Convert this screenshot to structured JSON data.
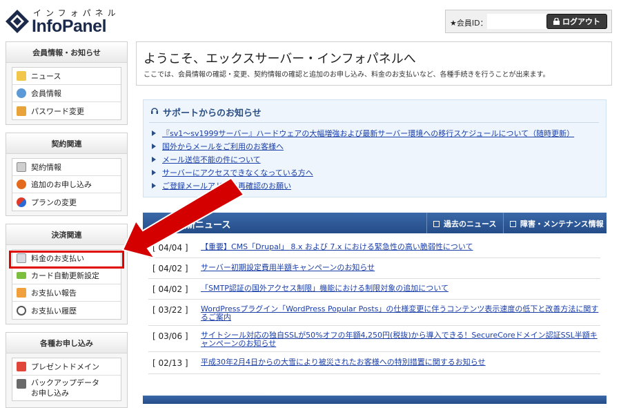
{
  "header": {
    "logo_kana": "インフォパネル",
    "logo_text": "InfoPanel",
    "member_label": "★会員ID：",
    "logout_label": "ログアウト"
  },
  "sidebar": {
    "sections": [
      {
        "title": "会員情報・お知らせ",
        "items": [
          "ニュース",
          "会員情報",
          "パスワード変更"
        ]
      },
      {
        "title": "契約関連",
        "items": [
          "契約情報",
          "追加のお申し込み",
          "プランの変更"
        ]
      },
      {
        "title": "決済関連",
        "items": [
          "料金のお支払い",
          "カード自動更新設定",
          "お支払い報告",
          "お支払い履歴"
        ]
      },
      {
        "title": "各種お申し込み",
        "items": [
          "プレゼントドメイン",
          "バックアップデータ",
          "お申し込み"
        ]
      }
    ]
  },
  "welcome": {
    "title": "ようこそ、エックスサーバー・インフォパネルへ",
    "subtitle": "ここでは、会員情報の確認・変更、契約情報の確認と追加のお申し込み、料金のお支払いなど、各種手続きを行うことが出来ます。"
  },
  "support": {
    "title": "サポートからのお知らせ",
    "items": [
      "『sv1〜sv1999サーバー』ハードウェアの大幅増強および最新サーバー環境への移行スケジュールについて（随時更新）",
      "国外からメールをご利用のお客様へ",
      "メール送信不能の件について",
      "サーバーにアクセスできなくなっている方へ",
      "ご登録メールアドレス再確認のお願い"
    ]
  },
  "news": {
    "title": "最新ニュース",
    "past_link": "過去のニュース",
    "maintenance_link": "障害・メンテナンス情報",
    "items": [
      {
        "date": "[ 04/04 ]",
        "text": "【重要】CMS「Drupal」 8.x および 7.x における緊急性の高い脆弱性について"
      },
      {
        "date": "[ 04/02 ]",
        "text": "サーバー初期設定費用半額キャンペーンのお知らせ"
      },
      {
        "date": "[ 04/02 ]",
        "text": "「SMTP認証の国外アクセス制限」機能における制限対象の追加について"
      },
      {
        "date": "[ 03/22 ]",
        "text": "WordPressプラグイン「WordPress Popular Posts」の仕様変更に伴うコンテンツ表示速度の低下と改善方法に関するご案内"
      },
      {
        "date": "[ 03/06 ]",
        "text": "サイトシール対応の独自SSLが50%オフの年額4,250円(税抜)から導入できる！SecureCoreドメイン認証SSL半額キャンペーンのお知らせ"
      },
      {
        "date": "[ 02/13 ]",
        "text": "平成30年2月4日からの大雪により被災されたお客様への特別措置に関するお知らせ"
      }
    ]
  },
  "colors": {
    "accent_blue": "#2a4f86",
    "highlight_red": "#e00000"
  }
}
